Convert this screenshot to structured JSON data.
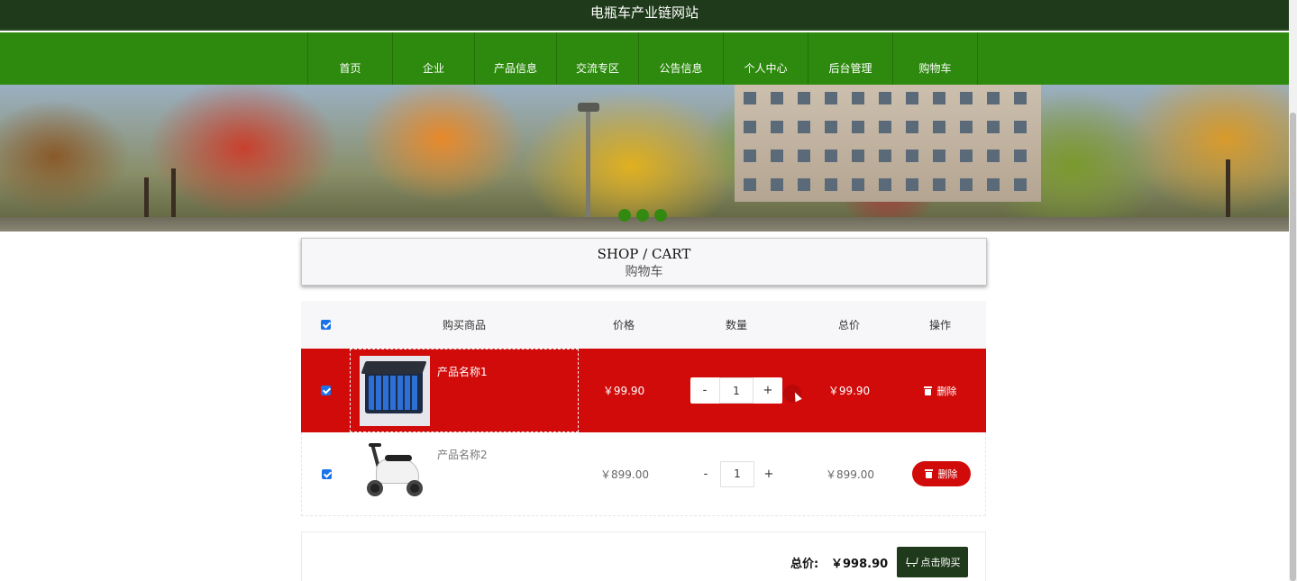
{
  "site": {
    "title": "电瓶车产业链网站"
  },
  "nav": {
    "items": [
      {
        "label": "首页"
      },
      {
        "label": "企业"
      },
      {
        "label": "产品信息"
      },
      {
        "label": "交流专区"
      },
      {
        "label": "公告信息"
      },
      {
        "label": "个人中心"
      },
      {
        "label": "后台管理"
      },
      {
        "label": "购物车"
      }
    ]
  },
  "banner": {
    "slide_count": 3,
    "active_slide": 2
  },
  "section": {
    "title_en": "SHOP / CART",
    "title_zh": "购物车"
  },
  "cart": {
    "headers": {
      "product": "购买商品",
      "price": "价格",
      "quantity": "数量",
      "total": "总价",
      "action": "操作"
    },
    "all_selected": true,
    "items": [
      {
        "name": "产品名称1",
        "price": "￥99.90",
        "quantity": "1",
        "total": "￥99.90",
        "delete_label": "删除",
        "selected": true,
        "highlighted": true,
        "image": "battery-pack-image"
      },
      {
        "name": "产品名称2",
        "price": "￥899.00",
        "quantity": "1",
        "total": "￥899.00",
        "delete_label": "删除",
        "selected": true,
        "highlighted": false,
        "image": "electric-scooter-image"
      }
    ],
    "decrement_label": "-",
    "increment_label": "+"
  },
  "summary": {
    "total_label": "总价:",
    "total_value": "￥998.90",
    "buy_label": "点击购买"
  },
  "colors": {
    "header_dark": "#1f3a1a",
    "nav_green": "#2e8a0e",
    "highlight_red": "#d10a0a",
    "checkbox_blue": "#1a73e8"
  }
}
